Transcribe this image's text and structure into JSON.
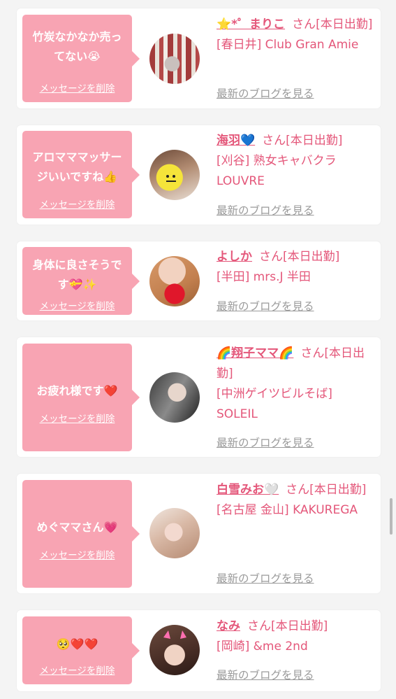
{
  "items": [
    {
      "message": "竹炭なかなか売ってない😭",
      "delete_label": "メッセージを削除",
      "name": "⭐️*゜まりこ",
      "san": "さん",
      "status": "[本日出勤]",
      "shop": "[春日井] Club Gran Amie",
      "blog_link": "最新のブログを見る"
    },
    {
      "message": "アロマママッサージいいですね👍",
      "delete_label": "メッセージを削除",
      "name": "海羽💙",
      "san": "さん",
      "status": "[本日出勤]",
      "shop": "[刈谷] 熟女キャバクラ LOUVRE",
      "blog_link": "最新のブログを見る"
    },
    {
      "message": "身体に良さそうです💝✨",
      "delete_label": "メッセージを削除",
      "name": "よしか",
      "san": "さん",
      "status": "[本日出勤]",
      "shop": "[半田] mrs.J 半田",
      "blog_link": "最新のブログを見る"
    },
    {
      "message": "お疲れ様です❤️",
      "delete_label": "メッセージを削除",
      "name": "🌈翔子ママ🌈",
      "san": "さん",
      "status": "[本日出勤]",
      "shop": "[中洲ゲイツビルそば] SOLEIL",
      "blog_link": "最新のブログを見る"
    },
    {
      "message": "めぐママさん💗",
      "delete_label": "メッセージを削除",
      "name": "白雪みお🤍",
      "san": "さん",
      "status": "[本日出勤]",
      "shop": "[名古屋 金山] KAKUREGA",
      "blog_link": "最新のブログを見る"
    },
    {
      "message": "🥺❤️❤️",
      "delete_label": "メッセージを削除",
      "name": "なみ",
      "san": "さん",
      "status": "[本日出勤]",
      "shop": "[岡崎] &me 2nd",
      "blog_link": "最新のブログを見る"
    }
  ],
  "colors": {
    "page_bg": "#f4f4f4",
    "card_bg": "#ffffff",
    "bubble_bg": "#f8a4b3",
    "accent_pink": "#e4577a",
    "link_gray": "#9a9a9a"
  }
}
